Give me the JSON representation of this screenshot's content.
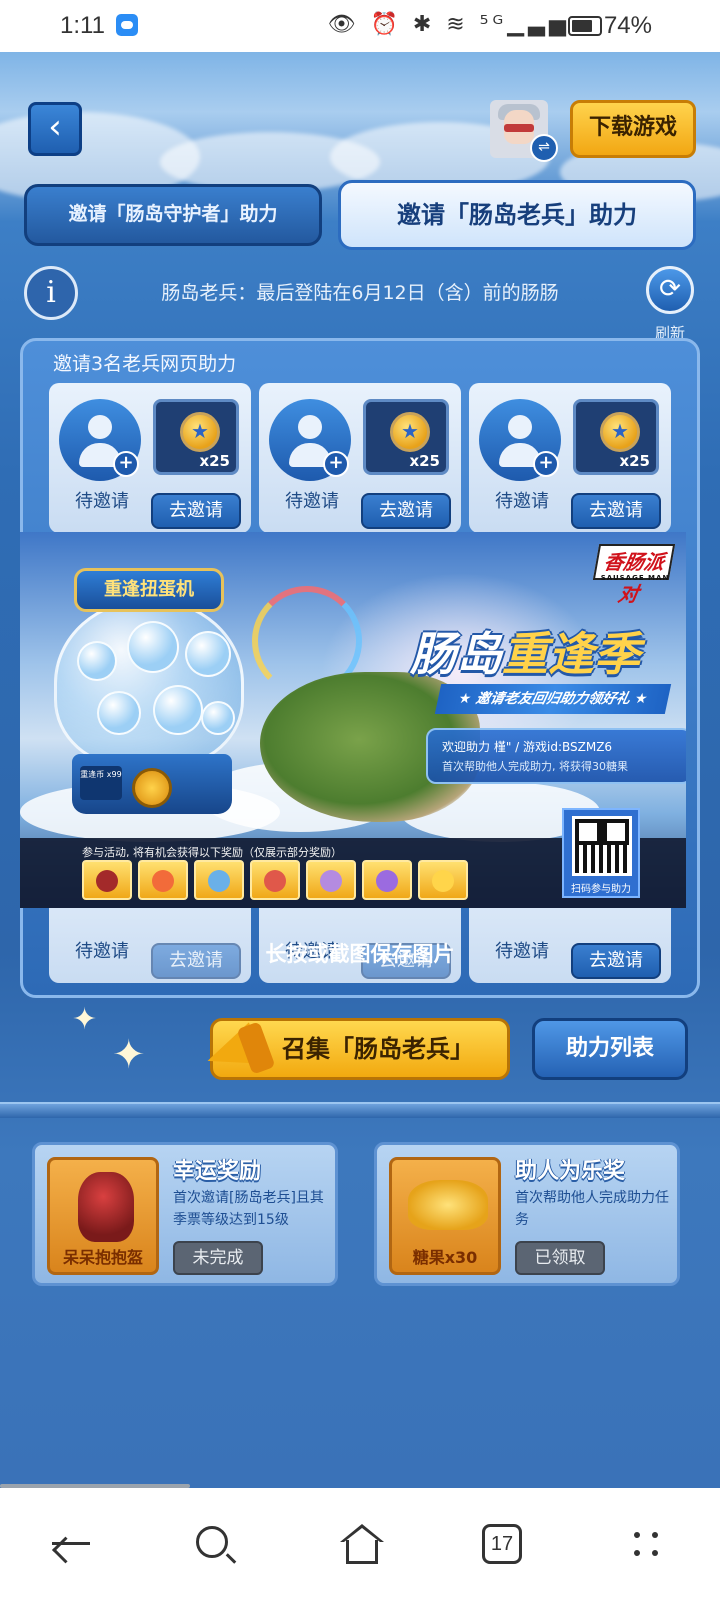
{
  "status_bar": {
    "time": "1:11",
    "icons_text": "👁 ⏰ ✱ ≋ ⁵ᴳ▁▃▅",
    "battery_percent": "74%"
  },
  "header": {
    "download_label": "下载游戏",
    "switch_icon_glyph": "⇌"
  },
  "tabs": [
    {
      "label": "邀请「肠岛守护者」助力",
      "active": false
    },
    {
      "label": "邀请「肠岛老兵」助力",
      "active": true
    }
  ],
  "info": {
    "text": "肠岛老兵：最后登陆在6月12日（含）前的肠肠",
    "refresh_label": "刷新"
  },
  "invite_panel": {
    "title": "邀请3名老兵网页助力",
    "slots": [
      {
        "status": "待邀请",
        "reward_qty": "x25",
        "button": "去邀请"
      },
      {
        "status": "待邀请",
        "reward_qty": "x25",
        "button": "去邀请"
      },
      {
        "status": "待邀请",
        "reward_qty": "x25",
        "button": "去邀请"
      }
    ],
    "hidden_slots": [
      {
        "status": "待邀请",
        "button": "去邀请"
      },
      {
        "status": "待邀请",
        "button": "去邀请"
      },
      {
        "status": "待邀请",
        "button": "去邀请"
      }
    ]
  },
  "banner": {
    "gacha_title": "重逢扭蛋机",
    "gacha_coin_tag": "重逢币 x99",
    "brand": "香肠派对",
    "brand_sub": "SAUSAGE MAN",
    "headline_white": "肠岛",
    "headline_gold": "重逢季",
    "ribbon": "★ 邀请老友回归助力领好礼 ★",
    "invite_line1": "欢迎助力 槿\" / 游戏id:BSZMZ6",
    "invite_line2": "首次帮助他人完成助力, 将获得30糖果",
    "strip_title": "参与活动, 将有机会获得以下奖励（仅展示部分奖励）",
    "qr_label": "扫码参与助力"
  },
  "save_hint": "长按或截图保存图片",
  "actions": {
    "summon_label": "召集「肠岛老兵」",
    "help_list_label": "助力列表"
  },
  "rewards": [
    {
      "title": "幸运奖励",
      "desc": "首次邀请[肠岛老兵]且其季票等级达到15级",
      "item": "呆呆抱抱盔",
      "status": "未完成"
    },
    {
      "title": "助人为乐奖",
      "desc": "首次帮助他人完成助力任务",
      "item": "糖果x30",
      "status": "已领取"
    }
  ],
  "nav": {
    "tabs_count": "17"
  },
  "colors": {
    "primary_blue": "#2e66ab",
    "gold_button": "#f2a90f",
    "status_disabled": "#5b6573"
  }
}
